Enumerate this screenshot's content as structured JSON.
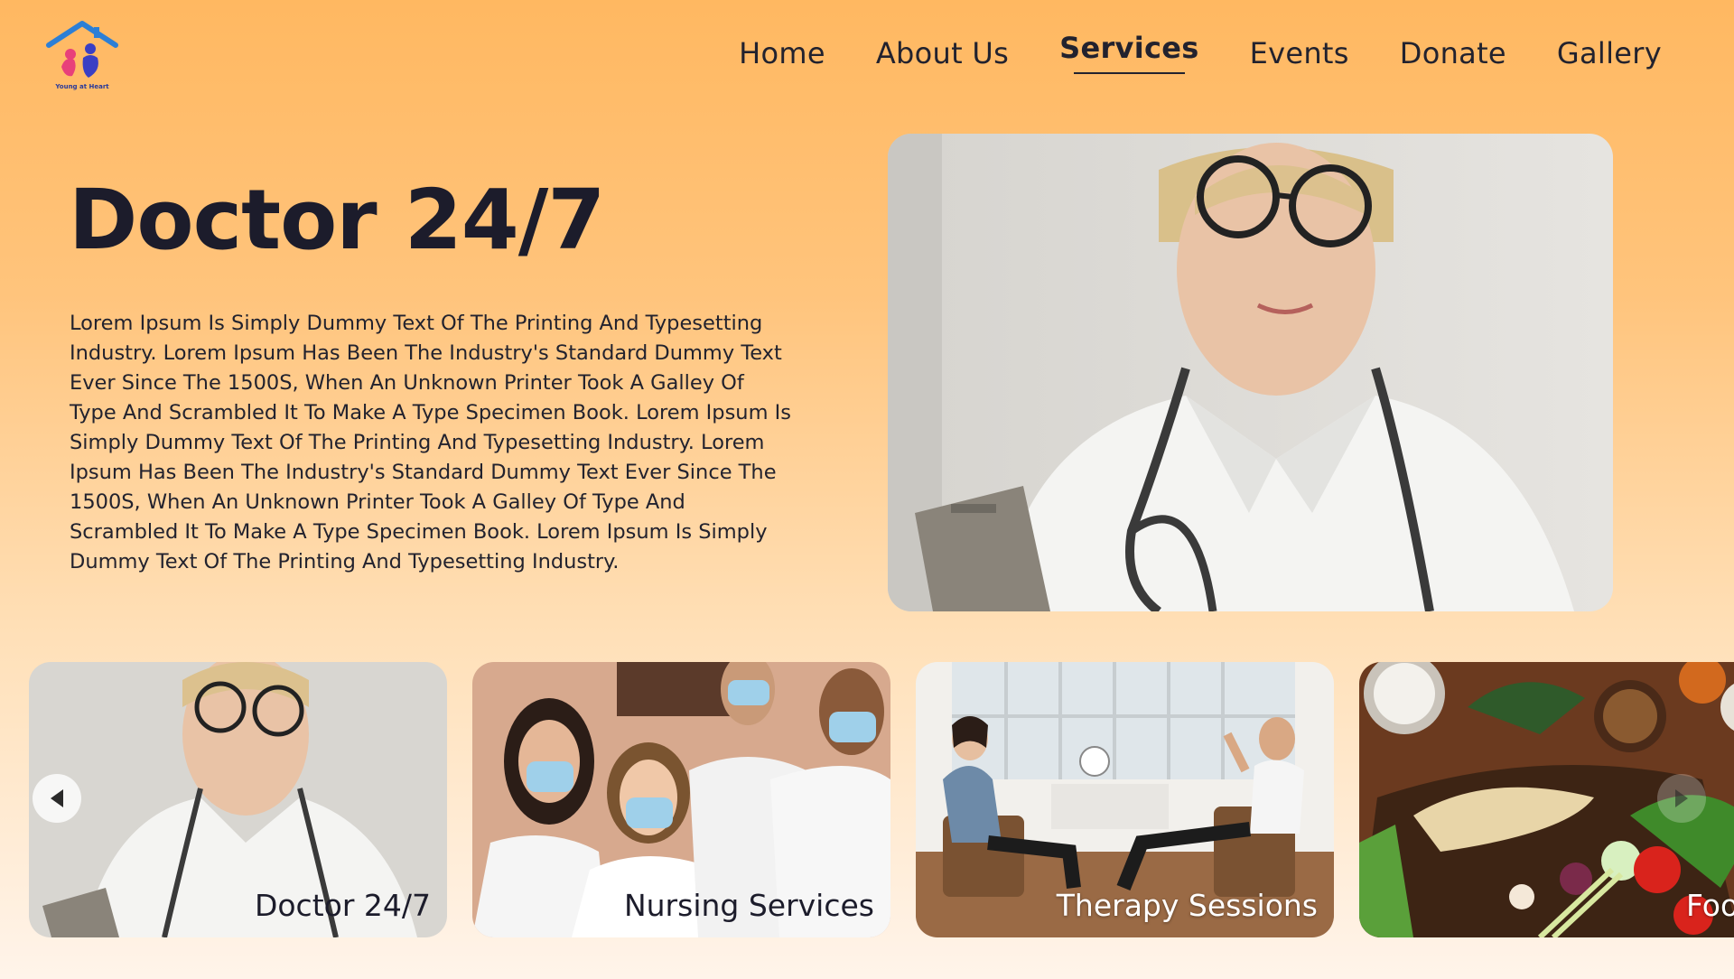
{
  "brand": {
    "logo_text": "Young at Heart",
    "logo_icon": "house-family-logo"
  },
  "nav": {
    "items": [
      {
        "label": "Home",
        "active": false
      },
      {
        "label": "About Us",
        "active": false
      },
      {
        "label": "Services",
        "active": true
      },
      {
        "label": "Events",
        "active": false
      },
      {
        "label": "Donate",
        "active": false
      },
      {
        "label": "Gallery",
        "active": false
      }
    ]
  },
  "hero": {
    "title": "Doctor 24/7",
    "description": "Lorem Ipsum Is Simply Dummy Text Of The Printing And Typesetting Industry. Lorem Ipsum Has Been The Industry's Standard Dummy Text Ever Since The 1500S, When An Unknown Printer Took A Galley Of Type And Scrambled It To Make A Type Specimen Book. Lorem Ipsum Is Simply Dummy Text Of The Printing And Typesetting Industry. Lorem Ipsum Has Been The Industry's Standard Dummy Text Ever Since The 1500S, When An Unknown Printer Took A Galley Of Type And Scrambled It To Make A Type Specimen Book. Lorem Ipsum Is Simply Dummy Text Of The Printing And Typesetting Industry."
  },
  "services": {
    "cards": [
      {
        "label": "Doctor 24/7"
      },
      {
        "label": "Nursing Services"
      },
      {
        "label": "Therapy Sessions"
      },
      {
        "label": "Foo"
      }
    ],
    "prev_icon": "arrow-left-icon",
    "next_icon": "arrow-right-icon"
  },
  "colors": {
    "accent": "#ffb861",
    "text": "#1c1c2b",
    "background_bottom": "#fff4ea"
  }
}
